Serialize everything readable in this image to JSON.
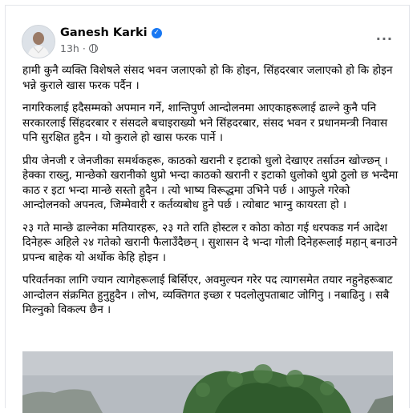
{
  "post": {
    "author": "Ganesh Karki",
    "time": "13h",
    "time_separator": "·",
    "paragraphs": [
      "हामी कुनै व्यक्ति विशेषले संसद भवन जलाएको हो कि होइन, सिंहदरबार जलाएको हो कि होइन भन्ने कुराले खास फरक पर्दैन ।",
      "नागरिकलाई हदैसम्मको अपमान गर्ने, शान्तिपुर्ण आन्दोलनमा आएकाहरूलाई ढाल्ने कुनै पनि सरकारलाई सिंहदरबार र संसदले बचाइराख्यो भने सिंहदरबार, संसद भवन र प्रधानमन्त्री निवास पनि सुरक्षित हुदैन । यो कुराले हो खास फरक पार्ने ।",
      "प्रीय जेनजी र जेनजीका समर्थकहरू, काठको खरानी र इटाको धुलो देखाएर तर्साउन खोज्छन् । हेक्का राख्नु, मान्छेको खरानीको थुप्रो भन्दा काठको खरानी र इटाको धुलोको थुप्रो ठुलो छ भन्दैमा काठ र इटा भन्दा मान्छे सस्तो हुदैन । त्यो भाष्य विरूद्धमा उभिने पर्छ । आफुले गरेको आन्दोलनको अपनत्व, जिम्मेवारी र कर्तव्यबोध हुने पर्छ । त्योबाट भाग्नु कायरता हो ।",
      "२३ गते मान्छे ढाल्नेका मतियारहरू, २३ गते राति होस्टल र कोठा कोठा गई धरपकड गर्न आदेश दिनेहरू अहिले २४ गतेको खरानी फैलाउँदैछन् । सुशासन दे भन्दा गोली दिनेहरूलाई महान् बनाउने प्रपन्च बाहेक यो अर्थोक केहि होइन ।",
      "परिवर्तनका लागि ज्यान त्यागेहरूलाई बिर्सिएर, अवमुल्यन गरेर पद त्यागसमेत तयार नहुनेहरूबाट आन्दोलन संक्रमित हुनुहुदैन । लोभ, व्यक्तिगत इच्छा र पदलोलुपताबाट जोगिनु । नबाढिनु । सबै मिल्नुको विकल्प छैन ।"
    ]
  },
  "icons": {
    "verified": "verified-badge-icon",
    "audience": "globe-icon",
    "more": "more-options-icon"
  },
  "colors": {
    "accent": "#1877f2",
    "secondary_text": "#65676b"
  }
}
